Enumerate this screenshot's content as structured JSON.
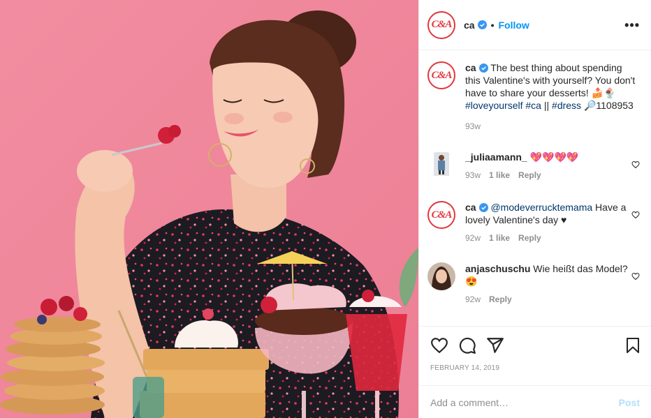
{
  "post": {
    "username": "ca",
    "follow_separator": "•",
    "follow_label": "Follow",
    "more_label": "•••",
    "logo_text": "C&A"
  },
  "caption": {
    "username": "ca",
    "text_before": " The best thing about spending this Valentine's with yourself? You don't have to share your desserts! 🍰🍨",
    "tag1": "#loveyourself",
    "tag2": "#ca",
    "sep": " || ",
    "tag3": "#dress",
    "text_after": " 🔎1108953",
    "time": "93w"
  },
  "comments": [
    {
      "username": "_juliaamann_",
      "text": " 💖💖💖💖",
      "time": "93w",
      "likes": "1 like",
      "reply": "Reply"
    },
    {
      "username": "ca",
      "mention": "@modeverrucktemama",
      "text": " Have a lovely Valentine's day ♥",
      "time": "92w",
      "likes": "1 like",
      "reply": "Reply"
    },
    {
      "username": "anjaschuschu",
      "text": " Wie heißt das Model? 😍",
      "time": "92w",
      "reply": "Reply"
    }
  ],
  "footer": {
    "date": "FEBRUARY 14, 2019",
    "comment_placeholder": "Add a comment…",
    "post_label": "Post"
  },
  "colors": {
    "brand": "#e1363c",
    "link": "#00376b",
    "follow": "#0095f6",
    "photo_bg": "#f08a9c"
  },
  "icons": [
    "heart-icon",
    "comment-icon",
    "share-icon",
    "bookmark-icon",
    "verified-icon"
  ]
}
